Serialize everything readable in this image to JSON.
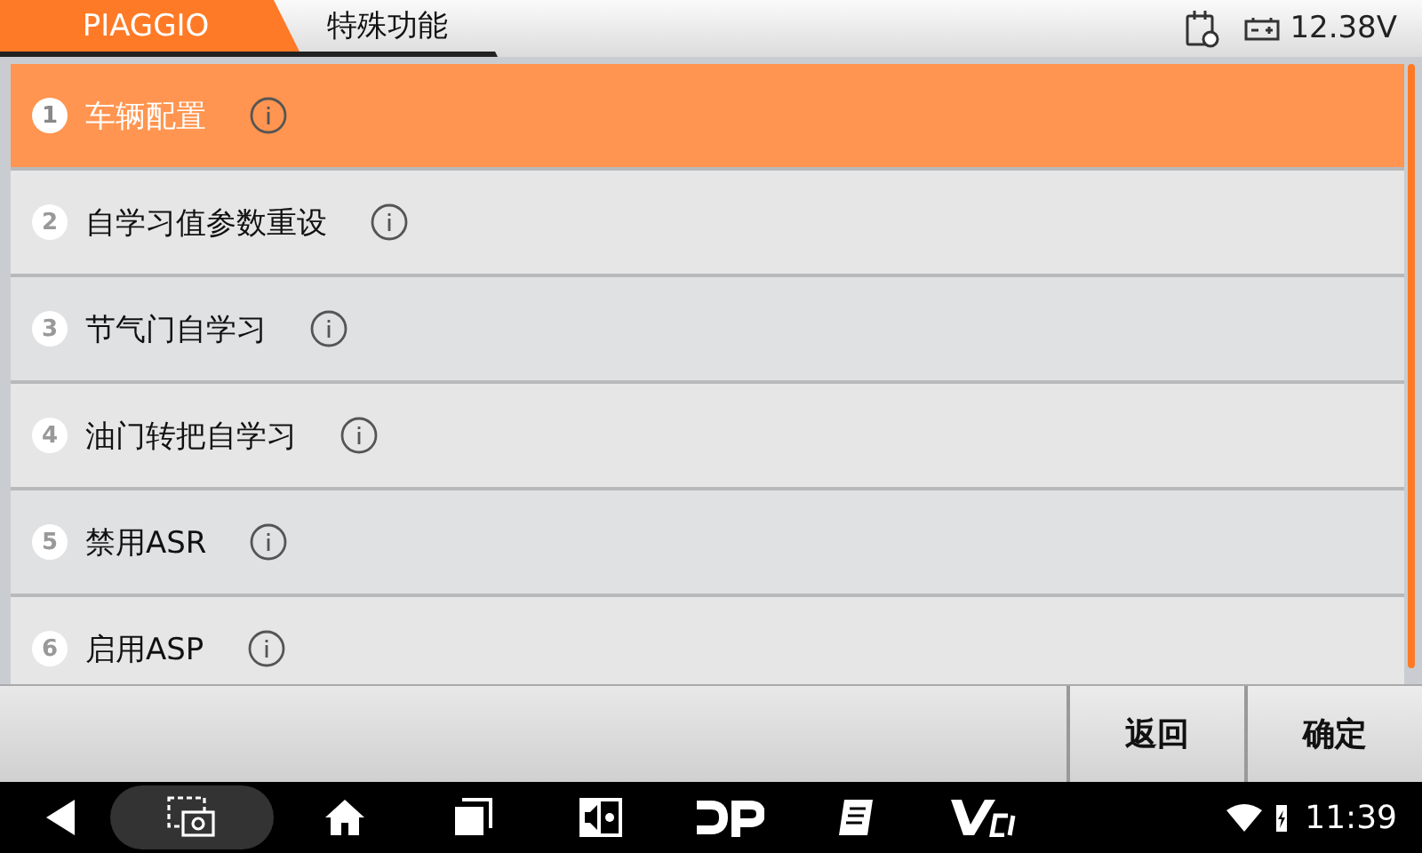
{
  "breadcrumb": [
    {
      "label": "PIAGGIO",
      "selected": true
    },
    {
      "label": "特殊功能",
      "selected": false
    }
  ],
  "status": {
    "voltage": "12.38V"
  },
  "items": [
    {
      "number": "1",
      "label": "车辆配置",
      "selected": true
    },
    {
      "number": "2",
      "label": "自学习值参数重设",
      "selected": false
    },
    {
      "number": "3",
      "label": "节气门自学习",
      "selected": false
    },
    {
      "number": "4",
      "label": "油门转把自学习",
      "selected": false
    },
    {
      "number": "5",
      "label": "禁用ASR",
      "selected": false
    },
    {
      "number": "6",
      "label": "启用ASP",
      "selected": false
    }
  ],
  "buttons": [
    "返回",
    "确定"
  ],
  "system_bar": {
    "time": "11:39"
  }
}
